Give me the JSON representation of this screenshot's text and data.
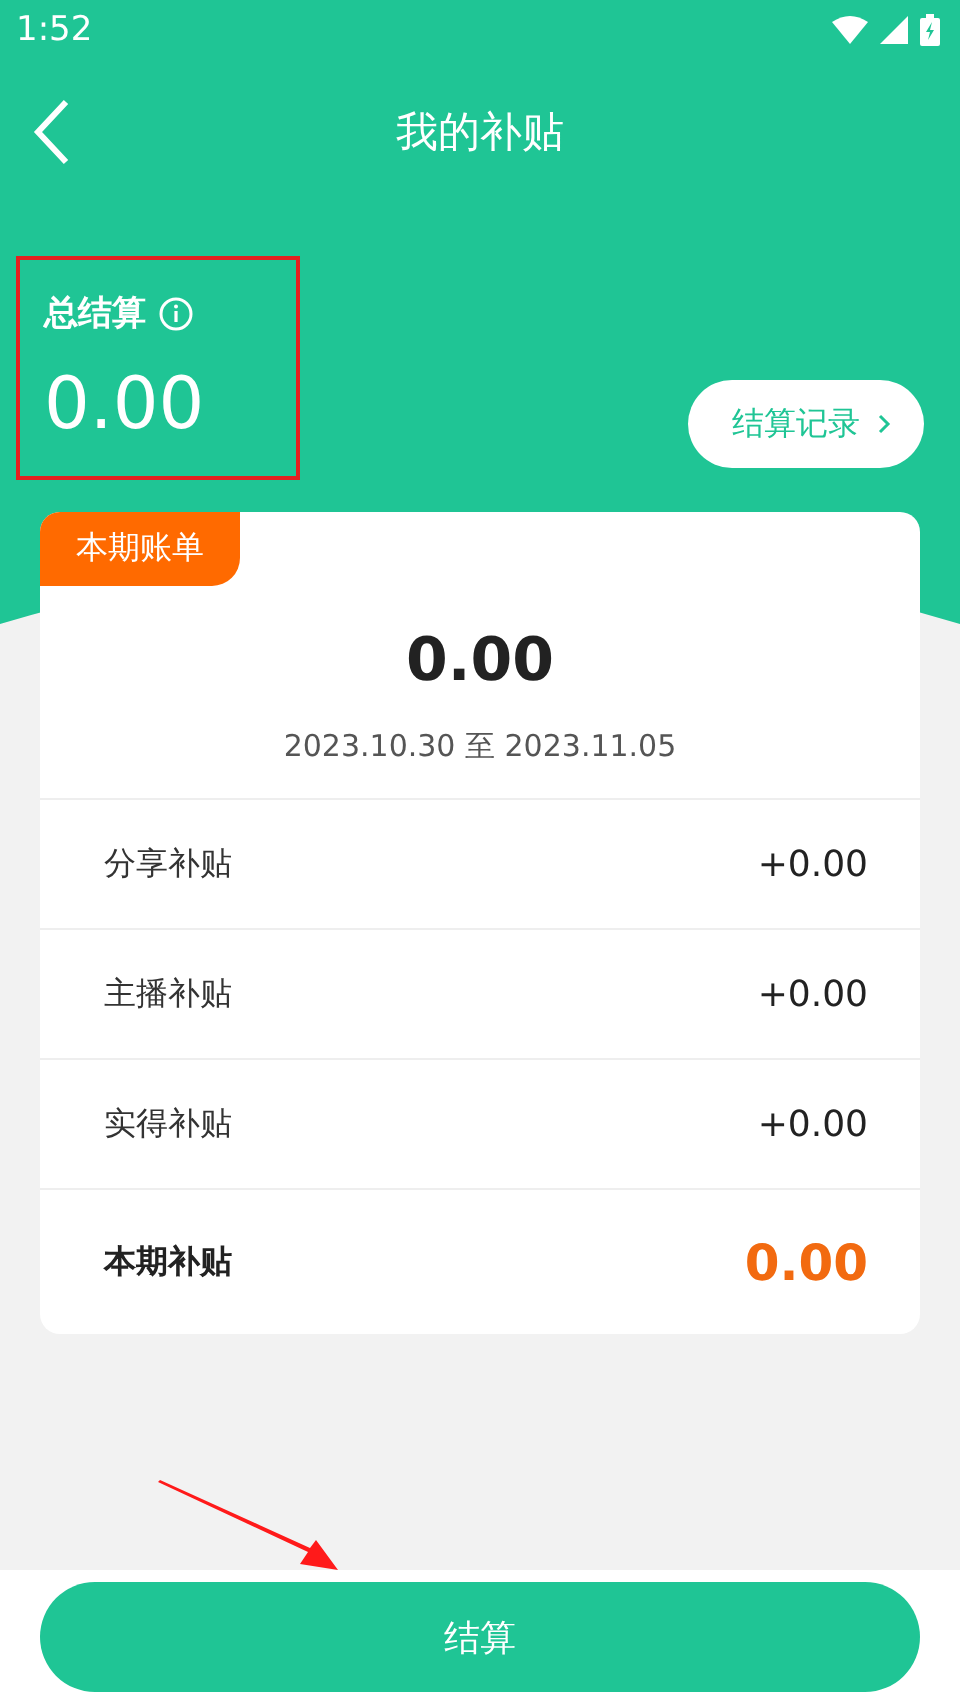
{
  "status_bar": {
    "time": "1:52"
  },
  "header": {
    "title": "我的补贴"
  },
  "summary": {
    "label": "总结算",
    "amount": "0.00",
    "records_button": "结算记录"
  },
  "bill": {
    "tag": "本期账单",
    "amount": "0.00",
    "period": "2023.10.30 至 2023.11.05",
    "rows": [
      {
        "kind": "item",
        "label": "分享补贴",
        "value": "+0.00"
      },
      {
        "kind": "item",
        "label": "主播补贴",
        "value": "+0.00"
      },
      {
        "kind": "item",
        "label": "实得补贴",
        "value": "+0.00"
      },
      {
        "kind": "total",
        "label": "本期补贴",
        "value": "0.00"
      }
    ]
  },
  "action_button": "结算"
}
